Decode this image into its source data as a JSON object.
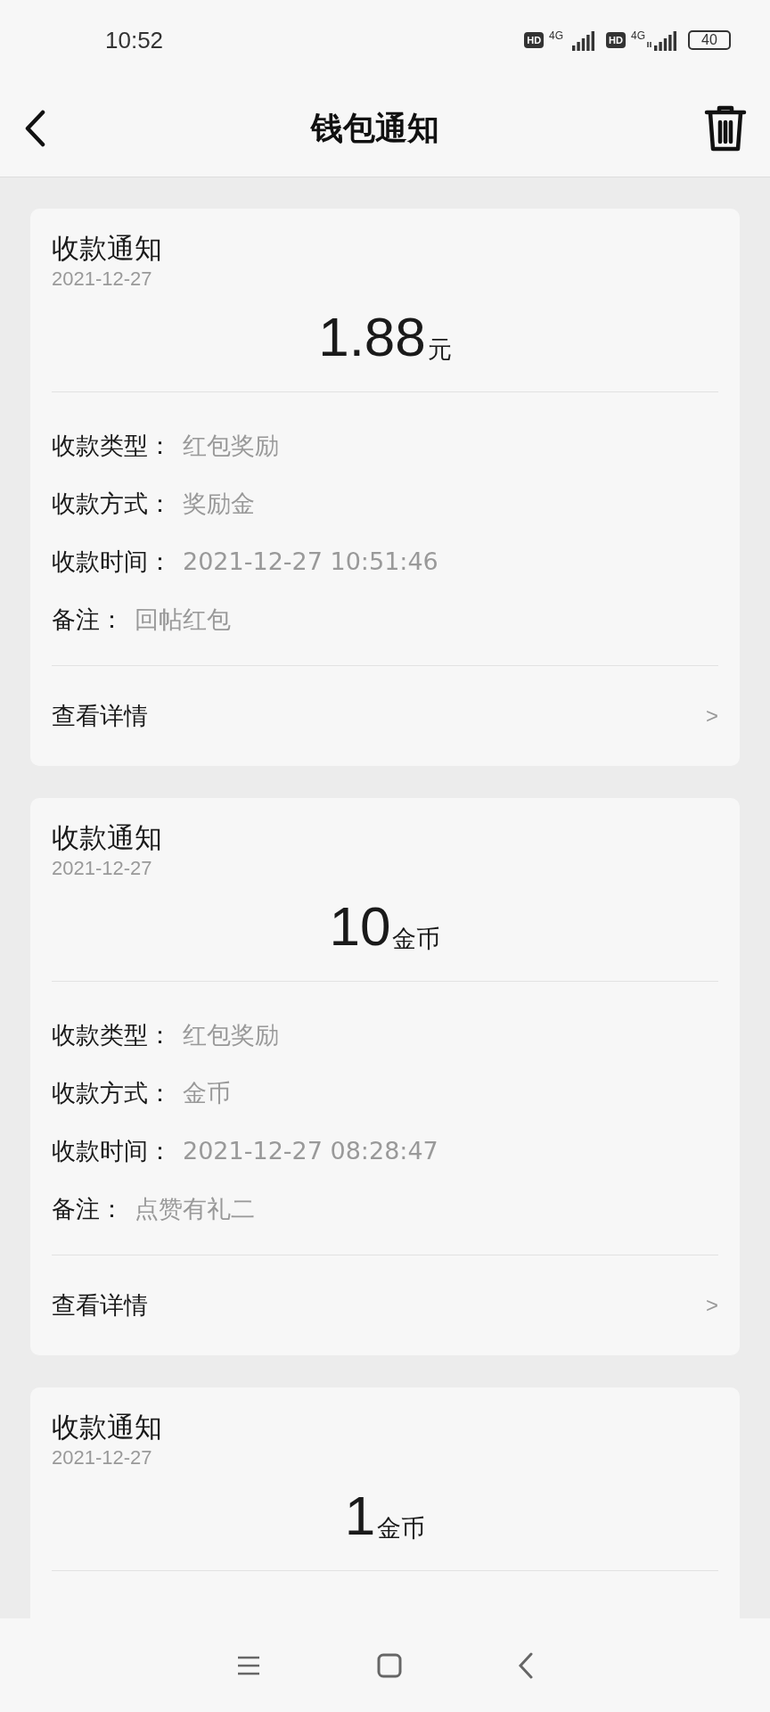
{
  "status_bar": {
    "time": "10:52",
    "sim_badges": [
      "HD",
      "HD"
    ],
    "network_labels": [
      "4G",
      "4G"
    ],
    "battery": "40"
  },
  "header": {
    "title": "钱包通知"
  },
  "notifications": [
    {
      "title": "收款通知",
      "date": "2021-12-27",
      "amount": "1.88",
      "unit": "元",
      "fields": [
        {
          "label": "收款类型：",
          "value": "红包奖励"
        },
        {
          "label": "收款方式：",
          "value": "奖励金"
        },
        {
          "label": "收款时间：",
          "value": "2021-12-27 10:51:46"
        },
        {
          "label": "备注：",
          "value": "回帖红包"
        }
      ],
      "link": "查看详情",
      "arrow": ">"
    },
    {
      "title": "收款通知",
      "date": "2021-12-27",
      "amount": "10",
      "unit": "金币",
      "fields": [
        {
          "label": "收款类型：",
          "value": "红包奖励"
        },
        {
          "label": "收款方式：",
          "value": "金币"
        },
        {
          "label": "收款时间：",
          "value": "2021-12-27 08:28:47"
        },
        {
          "label": "备注：",
          "value": "点赞有礼二"
        }
      ],
      "link": "查看详情",
      "arrow": ">"
    },
    {
      "title": "收款通知",
      "date": "2021-12-27",
      "amount": "1",
      "unit": "金币"
    }
  ]
}
